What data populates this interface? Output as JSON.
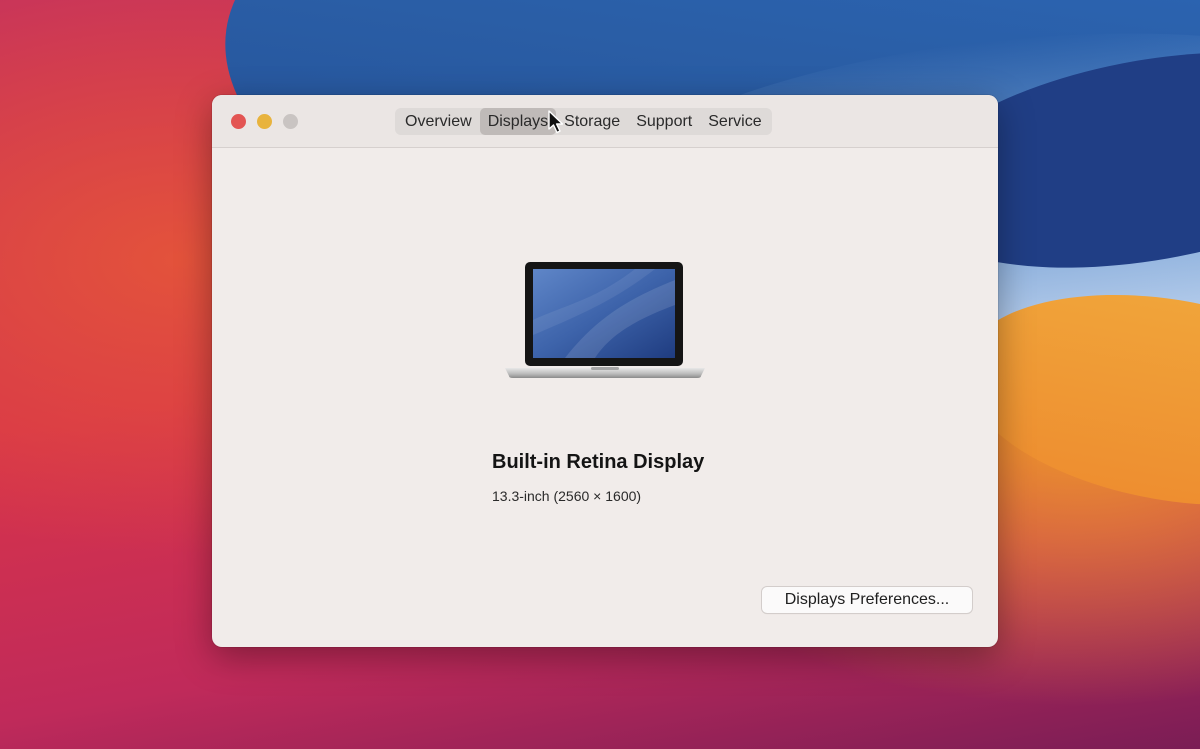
{
  "window": {
    "tabs": [
      {
        "label": "Overview",
        "active": false
      },
      {
        "label": "Displays",
        "active": true
      },
      {
        "label": "Storage",
        "active": false
      },
      {
        "label": "Support",
        "active": false
      },
      {
        "label": "Service",
        "active": false
      }
    ]
  },
  "display": {
    "title": "Built-in Retina Display",
    "details": "13.3-inch (2560 × 1600)"
  },
  "button": {
    "label": "Displays Preferences..."
  },
  "colors": {
    "close": "#e35553",
    "minimize": "#e8b33d",
    "zoom": "#c9c4c2",
    "window_bg": "#f1ecea",
    "active_tab": "#bfbab8"
  },
  "icons": [
    "laptop-icon",
    "cursor-icon"
  ]
}
